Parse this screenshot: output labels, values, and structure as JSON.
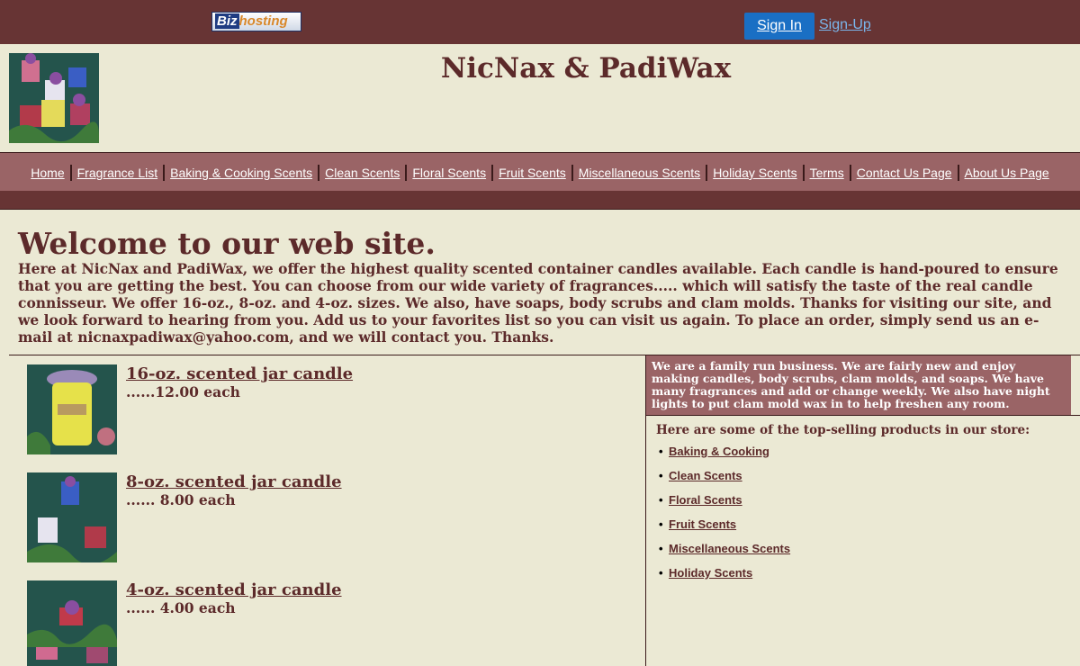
{
  "topbar": {
    "logo_biz": "Biz",
    "logo_hosting": "hosting",
    "signin_label": "Sign In",
    "signup_label": "Sign-Up"
  },
  "header": {
    "title": "NicNax & PadiWax"
  },
  "nav": {
    "items": [
      "Home",
      "Fragrance List",
      "Baking & Cooking Scents",
      "Clean Scents",
      "Floral Scents",
      "Fruit Scents",
      "Miscellaneous Scents",
      "Holiday Scents",
      "Terms",
      "Contact Us Page",
      "About Us Page"
    ]
  },
  "main": {
    "welcome": "Welcome to our web site.",
    "intro": "Here at NicNax and PadiWax, we offer the highest quality scented container candles available. Each candle is hand-poured to ensure that you are getting the best. You can choose from our wide variety of fragrances..... which will satisfy the taste of the real candle connisseur. We offer 16-oz., 8-oz. and 4-oz. sizes. We also, have soaps, body scrubs and clam molds. Thanks for visiting our site, and we look forward to hearing from you. Add us to your favorites list so you can visit us again. To place an order, simply send us an e-mail at nicnaxpadiwax@yahoo.com, and we will contact you. Thanks."
  },
  "products": [
    {
      "name": "16-oz. scented jar candle",
      "price": "......12.00 each"
    },
    {
      "name": "8-oz. scented jar candle",
      "price": "...... 8.00 each"
    },
    {
      "name": "4-oz. scented jar candle",
      "price": "...... 4.00 each"
    }
  ],
  "sidebar": {
    "about": "We are a family run business. We are fairly new and enjoy making candles, body scrubs, clam molds, and soaps. We have many fragrances and add or change weekly. We also have night lights to put clam mold wax in to help freshen any room.",
    "top_selling_heading": "Here are some of the top-selling products in our store:",
    "top_selling": [
      "Baking & Cooking",
      "Clean Scents",
      "Floral Scents",
      "Fruit Scents",
      "Miscellaneous Scents",
      "Holiday Scents"
    ]
  },
  "colors": {
    "topbar": "#673434",
    "navbar": "#9a6466",
    "page_bg": "#ebe9d4",
    "text": "#5c2a2a",
    "signin_button": "#1a6fc4"
  }
}
